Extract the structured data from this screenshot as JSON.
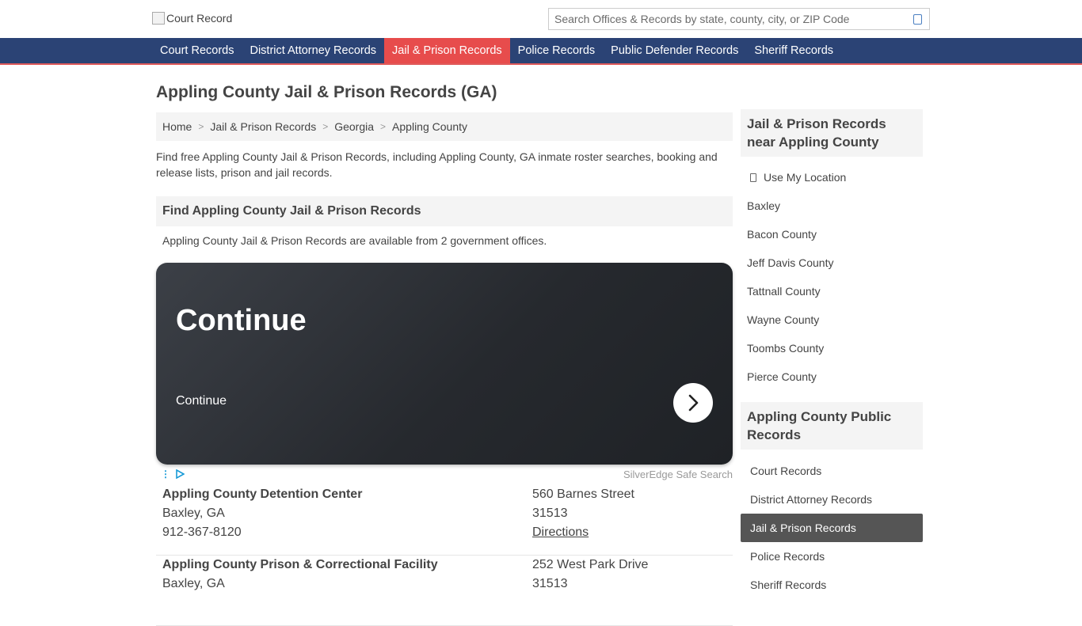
{
  "header": {
    "logo_alt": "Court Record",
    "search_placeholder": "Search Offices & Records by state, county, city, or ZIP Code"
  },
  "nav": {
    "items": [
      {
        "label": "Court Records"
      },
      {
        "label": "District Attorney Records"
      },
      {
        "label": "Jail & Prison Records",
        "active": true
      },
      {
        "label": "Police Records"
      },
      {
        "label": "Public Defender Records"
      },
      {
        "label": "Sheriff Records"
      }
    ]
  },
  "main": {
    "title": "Appling County Jail & Prison Records (GA)",
    "breadcrumb": [
      "Home",
      "Jail & Prison Records",
      "Georgia",
      "Appling County"
    ],
    "intro": "Find free Appling County Jail & Prison Records, including Appling County, GA inmate roster searches, booking and release lists, prison and jail records.",
    "find_heading": "Find Appling County Jail & Prison Records",
    "availability": "Appling County Jail & Prison Records are available from 2 government offices."
  },
  "ad": {
    "title": "Continue",
    "subtitle": "Continue",
    "brand": "SilverEdge Safe Search"
  },
  "offices": [
    {
      "name": "Appling County Detention Center",
      "city": "Baxley, GA",
      "phone": "912-367-8120",
      "street": "560 Barnes Street",
      "zip": "31513",
      "directions": "Directions"
    },
    {
      "name": "Appling County Prison & Correctional Facility",
      "city": "Baxley, GA",
      "phone": "",
      "street": "252 West Park Drive",
      "zip": "31513",
      "directions": ""
    }
  ],
  "sidebar": {
    "near_heading": "Jail & Prison Records near Appling County",
    "use_location": "Use My Location",
    "near_items": [
      "Baxley",
      "Bacon County",
      "Jeff Davis County",
      "Tattnall County",
      "Wayne County",
      "Toombs County",
      "Pierce County"
    ],
    "public_heading": "Appling County Public Records",
    "public_items": [
      "Court Records",
      "District Attorney Records",
      "Jail & Prison Records",
      "Police Records",
      "Sheriff Records"
    ],
    "public_active": "Jail & Prison Records"
  },
  "colors": {
    "nav_bg": "#2b4375",
    "nav_active": "#e74c4c",
    "sidebar_active": "#555555"
  }
}
